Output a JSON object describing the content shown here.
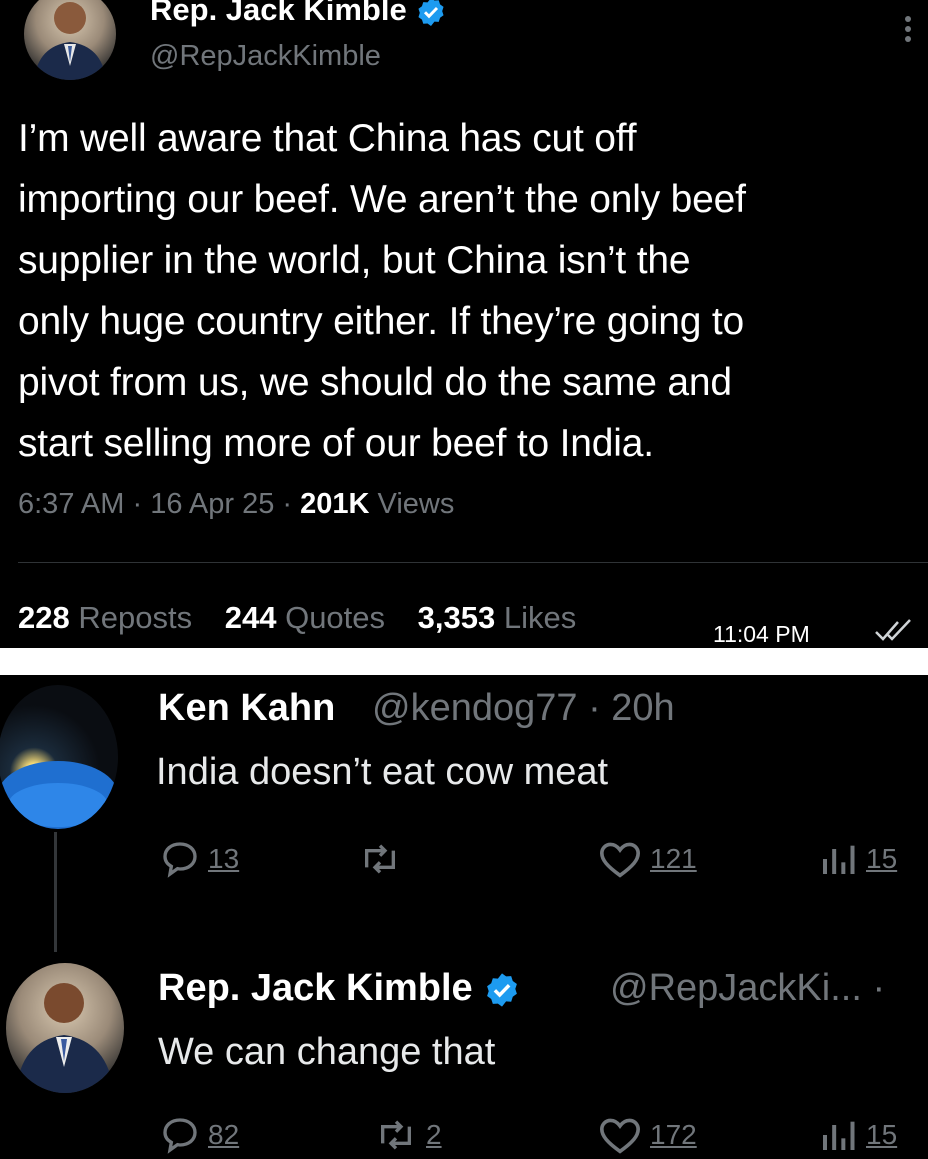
{
  "main_tweet": {
    "author_name": "Rep. Jack Kimble",
    "handle": "@RepJackKimble",
    "text_lines": [
      "I’m well aware that China has cut off",
      "importing our beef. We aren’t the only beef",
      "supplier in the world, but China isn’t the",
      "only huge country either. If they’re going to",
      "pivot from us, we should do the same and",
      "start selling more of our beef to India."
    ],
    "time": "6:37 AM",
    "date": "16 Apr 25",
    "views_count": "201K",
    "views_label": "Views",
    "separator": "·",
    "reposts_count": "228",
    "reposts_label": "Reposts",
    "quotes_count": "244",
    "quotes_label": "Quotes",
    "likes_count": "3,353",
    "likes_label": "Likes"
  },
  "overlay": {
    "timestamp": "11:04 PM"
  },
  "reply_1": {
    "author_name": "Ken Kahn",
    "handle_time": "@kendog77 · 20h",
    "text": "India doesn’t eat cow meat",
    "replies": "13",
    "reposts": "",
    "likes": "121",
    "views": "15"
  },
  "reply_2": {
    "author_name": "Rep. Jack Kimble",
    "handle": "@RepJackKi... ·",
    "text": "We can change that",
    "replies": "82",
    "reposts": "2",
    "likes": "172",
    "views": "15"
  },
  "colors": {
    "background": "#000000",
    "text": "#e7e9ea",
    "muted": "#71767b",
    "verified": "#1d9bf0"
  },
  "icons": [
    "verified-badge-icon",
    "more-icon",
    "reply-icon",
    "repost-icon",
    "like-icon",
    "views-icon",
    "double-check-icon"
  ]
}
